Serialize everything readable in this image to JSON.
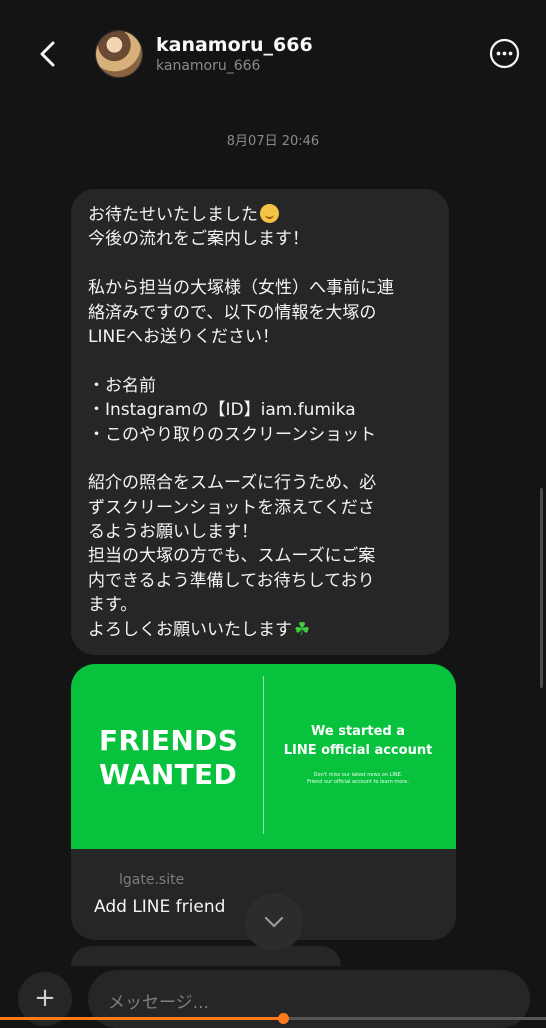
{
  "header": {
    "name": "kanamoru_666",
    "handle": "kanamoru_666"
  },
  "timestamp": "8月07日 20:46",
  "message": {
    "lines": [
      "お待たせいたしました",
      "今後の流れをご案内します！",
      "",
      "私から担当の大塚様（女性）へ事前に連",
      "絡済みですので、以下の情報を大塚の",
      "LINEへお送りください！",
      "",
      "・お名前",
      "・Instagramの【ID】iam.fumika",
      "・このやり取りのスクリーンショット",
      "",
      "紹介の照合をスムーズに行うため、必",
      "ずスクリーンショットを添えてくださ",
      "るようお願いします！",
      "担当の大塚の方でも、スムーズにご案",
      "内できるよう準備してお待ちしており",
      "ます。",
      "よろしくお願いいたします"
    ]
  },
  "link_card": {
    "banner_left": "FRIENDS\nWANTED",
    "banner_right_title": "We started a\nLINE official account",
    "banner_right_sub": "Don't miss our latest news on LINE.\nFriend our official account to learn more.",
    "domain": "lgate.site",
    "title": "Add LINE friend"
  },
  "composer": {
    "placeholder": "メッセージ..."
  },
  "icons": [
    "back-arrow-icon",
    "more-options-icon",
    "chevron-down-icon",
    "plus-icon",
    "smiling-face-emoji",
    "clover-emoji"
  ],
  "colors": {
    "background": "#141414",
    "bubble": "#262626",
    "line_green": "#08C23D",
    "accent": "#FF7A1A"
  }
}
